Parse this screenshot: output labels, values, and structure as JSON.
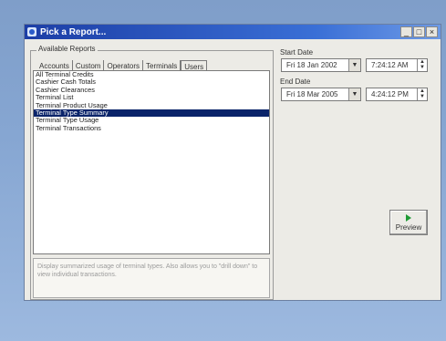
{
  "window": {
    "title": "Pick a Report...",
    "min": "_",
    "max": "□",
    "close": "×"
  },
  "reports": {
    "legend": "Available Reports",
    "tabs": [
      "Accounts",
      "Custom",
      "Operators",
      "Terminals",
      "Users"
    ],
    "active_tab": "Terminals",
    "items": [
      "All Terminal Credits",
      "Cashier Cash Totals",
      "Cashier Clearances",
      "Terminal List",
      "Terminal Product Usage",
      "Terminal Type Summary",
      "Terminal Type Usage",
      "Terminal Transactions"
    ],
    "selected_item": "Terminal Type Summary",
    "description": "Display summarized usage of terminal types. Also allows you to \"drill down\" to view individual transactions."
  },
  "start": {
    "label": "Start Date",
    "date": "Fri  18 Jan 2002",
    "time": "7:24:12 AM"
  },
  "end": {
    "label": "End Date",
    "date": "Fri  18 Mar 2005",
    "time": "4:24:12 PM"
  },
  "preview": {
    "label": "Preview"
  },
  "colors": {
    "titlebar": "#1c3ea6",
    "selection": "#0a246a",
    "background": "#86a6d2"
  }
}
